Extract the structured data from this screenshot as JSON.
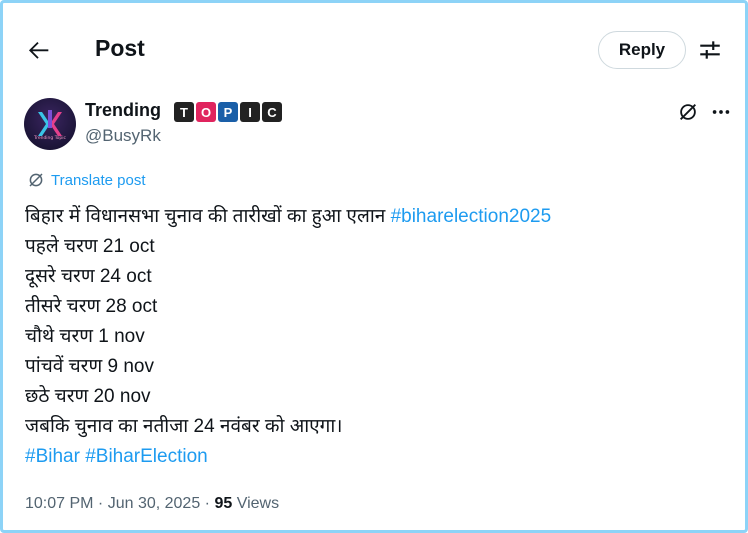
{
  "header": {
    "title": "Post",
    "reply_label": "Reply"
  },
  "author": {
    "display_name": "Trending",
    "badges": [
      {
        "letter": "T",
        "color": "#222222"
      },
      {
        "letter": "O",
        "color": "#e0245e"
      },
      {
        "letter": "P",
        "color": "#1a5fa8"
      },
      {
        "letter": "I",
        "color": "#222222"
      },
      {
        "letter": "C",
        "color": "#222222"
      }
    ],
    "handle": "@BusyRk",
    "avatar_text": "Trending Topic"
  },
  "translate_label": "Translate post",
  "post": {
    "line1_text": "बिहार में विधानसभा चुनाव की तारीखों का हुआ एलान ",
    "line1_tag": "#biharelection2025",
    "lines": [
      "पहले चरण 21 oct",
      "दूसरे चरण 24 oct",
      "तीसरे चरण 28 oct",
      "चौथे चरण 1 nov",
      "पांचवें चरण 9 nov",
      "छठे चरण 20 nov",
      "जबकि चुनाव का नतीजा 24 नवंबर को आएगा।"
    ],
    "hashtags": [
      "#Bihar",
      "#BiharElection"
    ]
  },
  "meta": {
    "time": "10:07 PM",
    "sep": " · ",
    "date": "Jun 30, 2025",
    "views_count": "95",
    "views_label": " Views"
  },
  "colors": {
    "accent": "#1d9bf0",
    "secondary_text": "#536471",
    "frame_border": "#8dd3f7"
  }
}
